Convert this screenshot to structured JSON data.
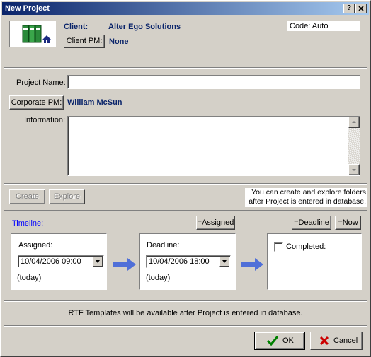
{
  "window": {
    "title": "New Project",
    "help_btn": "?",
    "close_btn": "X"
  },
  "icons": {
    "project": "folders-home-icon",
    "arrow": "right-arrow-icon",
    "ok": "checkmark-icon",
    "cancel": "red-x-icon"
  },
  "header": {
    "client_label": "Client:",
    "client_value": "Alter Ego Solutions",
    "client_pm_button": "Client PM:",
    "client_pm_value": "None",
    "code_value": "Code: Auto"
  },
  "form": {
    "project_name_label": "Project Name:",
    "project_name_value": "",
    "corporate_pm_button": "Corporate PM:",
    "corporate_pm_value": "William McSun",
    "information_label": "Information:",
    "information_value": ""
  },
  "folders": {
    "create_button": "Create",
    "explore_button": "Explore",
    "note": "You can create and explore folders after Project is entered in database."
  },
  "timeline": {
    "label": "Timeline:",
    "assigned_eq_button": "=Assigned",
    "deadline_eq_button": "=Deadline",
    "now_button": "=Now",
    "assigned_label": "Assigned:",
    "assigned_value": "10/04/2006 09:00",
    "assigned_note": "(today)",
    "deadline_label": "Deadline:",
    "deadline_value": "10/04/2006 18:00",
    "deadline_note": "(today)",
    "completed_label": "Completed:",
    "completed_checked": false
  },
  "templates_note": "RTF Templates will be available after Project is entered in database.",
  "footer": {
    "ok_button": "OK",
    "cancel_button": "Cancel"
  },
  "colors": {
    "face": "#d4d0c8",
    "title_start": "#0a246a",
    "title_end": "#a6caf0",
    "value_text": "#0a246a",
    "timeline_text": "#0000ff",
    "arrow": "#4f6fd8",
    "ok_check": "#008000",
    "cancel_x": "#cc0000"
  }
}
